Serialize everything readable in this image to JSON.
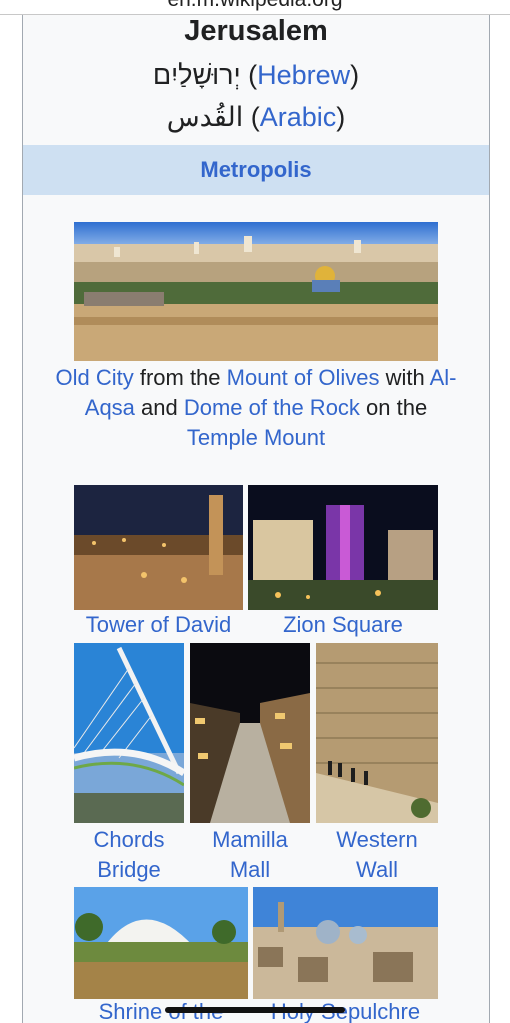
{
  "browser": {
    "url": "en.m.wikipedia.org"
  },
  "infobox": {
    "title": "Jerusalem",
    "hebrew_name": "יְרוּשָׁלַיִם",
    "hebrew_link": "Hebrew",
    "arabic_name": "القُدس",
    "arabic_link": "Arabic",
    "open_paren": "(",
    "close_paren": ")",
    "category": "Metropolis"
  },
  "gallery": {
    "main_caption": {
      "parts": [
        {
          "text": "Old City",
          "link": true
        },
        {
          "text": " from the ",
          "link": false
        },
        {
          "text": "Mount of Olives",
          "link": true
        },
        {
          "text": " with ",
          "link": false
        },
        {
          "text": "Al-Aqsa",
          "link": true
        },
        {
          "text": " and ",
          "link": false
        },
        {
          "text": "Dome of the Rock",
          "link": true
        },
        {
          "text": " on the ",
          "link": false
        },
        {
          "text": "Temple Mount",
          "link": true
        }
      ]
    },
    "items": [
      {
        "caption": "Tower of David"
      },
      {
        "caption": "Zion Square"
      },
      {
        "caption_line1": "Chords",
        "caption_line2": "Bridge"
      },
      {
        "caption_line1": "Mamilla",
        "caption_line2": "Mall"
      },
      {
        "caption_line1": "Western",
        "caption_line2": "Wall"
      },
      {
        "caption": "Shrine of the Book"
      },
      {
        "caption": "Holy Sepulchre"
      }
    ]
  },
  "colors": {
    "link": "#3366cc",
    "header_bg": "#cee0f2",
    "infobox_bg": "#f8f9fa"
  }
}
